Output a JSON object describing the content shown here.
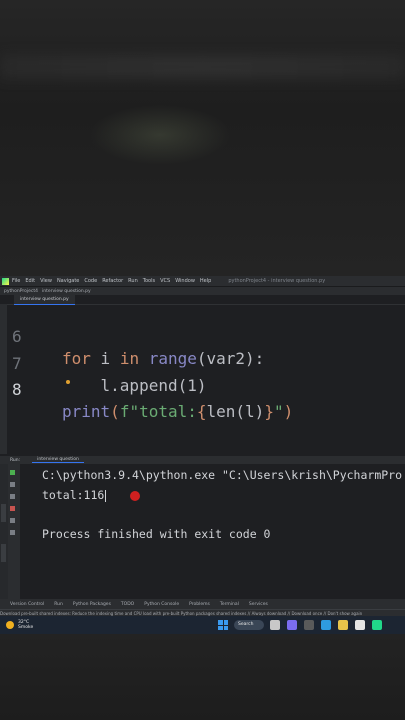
{
  "menu": {
    "items": [
      "File",
      "Edit",
      "View",
      "Navigate",
      "Code",
      "Refactor",
      "Run",
      "Tools",
      "VCS",
      "Window",
      "Help"
    ],
    "title": "pythonProject4 - interview question.py"
  },
  "nav": {
    "project": "pythonProject4",
    "file": "interview question.py"
  },
  "editor": {
    "tab_label": "interview question.py",
    "lines": [
      {
        "number": "6",
        "indent": "",
        "kw": "for",
        "mid1": " i ",
        "kw2": "in",
        "fn": " range",
        "rest": "(var2):"
      },
      {
        "number": "7",
        "text": "    l.append(1)"
      },
      {
        "number": "8",
        "print": "print",
        "open": "(",
        "fstr_a": "f\"total:",
        "lbrace": "{",
        "expr": "len(l)",
        "rbrace": "}",
        "fstr_b": "\"",
        "close": ")"
      }
    ]
  },
  "run_panel": {
    "header_label": "Run:",
    "tab_label": "interview question",
    "output": [
      "C:\\python3.9.4\\python.exe \"C:\\Users\\krish\\PycharmPro",
      "total:116",
      "",
      "Process finished with exit code 0"
    ]
  },
  "bottom_tools": [
    "Version Control",
    "Run",
    "Python Packages",
    "TODO",
    "Python Console",
    "Problems",
    "Terminal",
    "Services"
  ],
  "status_text": "Download pre-built shared indexes: Reduce the indexing time and CPU load with pre-built Python packages shared indexes // Always download // Download once // Don't show again",
  "taskbar": {
    "weather_temp": "32°C",
    "weather_desc": "Smoke",
    "search_label": "Search"
  },
  "colors": {
    "editor_bg": "#1e1f22",
    "keyword": "#cf8e6d",
    "string": "#6aab73",
    "builtin": "#8888c6",
    "cursor_dot": "#d02020"
  }
}
